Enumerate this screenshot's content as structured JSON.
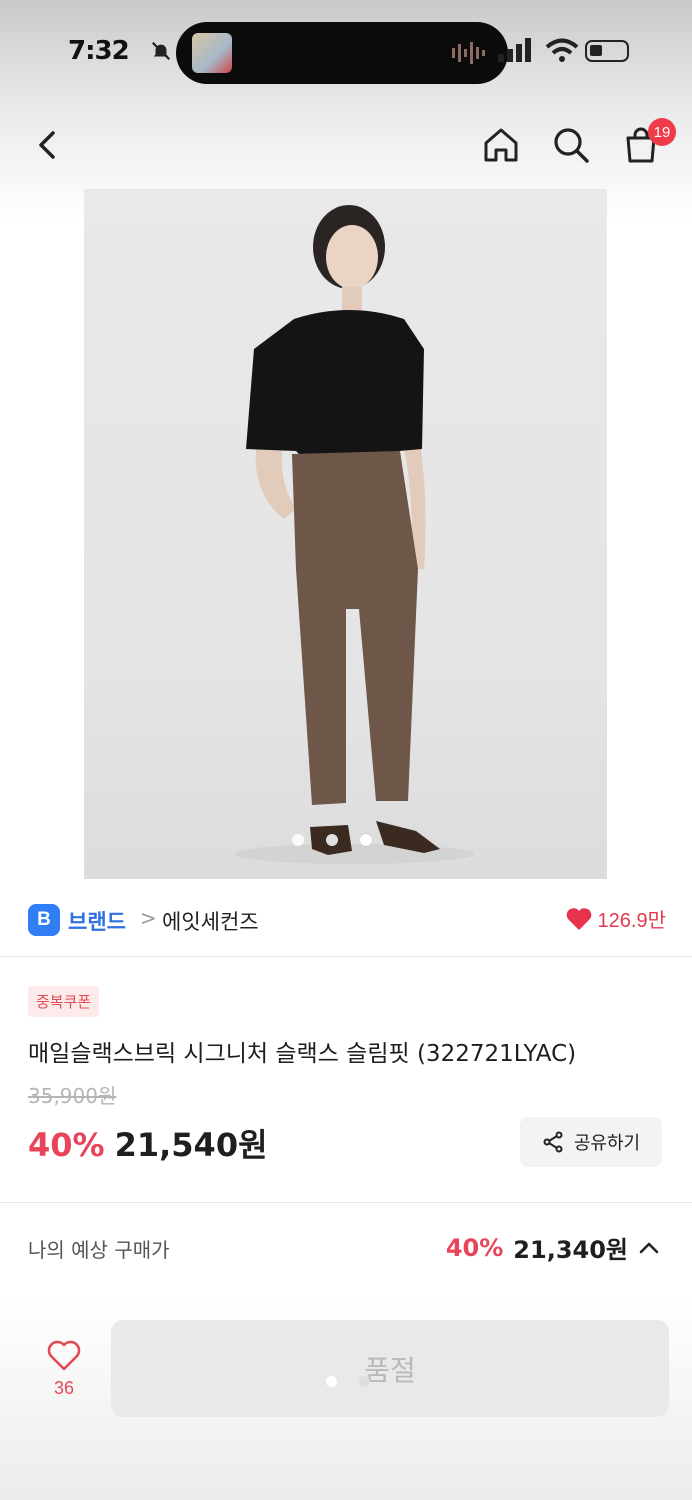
{
  "status_bar": {
    "time": "7:32"
  },
  "nav": {
    "cart_count": "19"
  },
  "product": {
    "brand_badge": "B",
    "brand_label": "브랜드",
    "breadcrumb_sep": ">",
    "brand_name": "에잇세컨즈",
    "likes": "126.9만",
    "coupon_tag": "중복쿠폰",
    "title": "매일슬랙스브릭 시그니처 슬랙스 슬림핏 (322721LYAC)",
    "original_price": "35,900원",
    "discount_pct": "40%",
    "sale_price": "21,540원",
    "share_label": "공유하기"
  },
  "estimate": {
    "label": "나의 예상 구매가",
    "discount_pct": "40%",
    "price": "21,340원"
  },
  "bottom_bar": {
    "wish_count": "36",
    "soldout_label": "품절"
  },
  "colors": {
    "accent_red": "#e8455a",
    "brand_blue": "#2f7ef5",
    "badge_red": "#ef3b4a"
  },
  "icons": [
    "back-icon",
    "home-icon",
    "search-icon",
    "shopping-bag-icon",
    "heart-icon",
    "share-icon",
    "chevron-up-icon"
  ]
}
